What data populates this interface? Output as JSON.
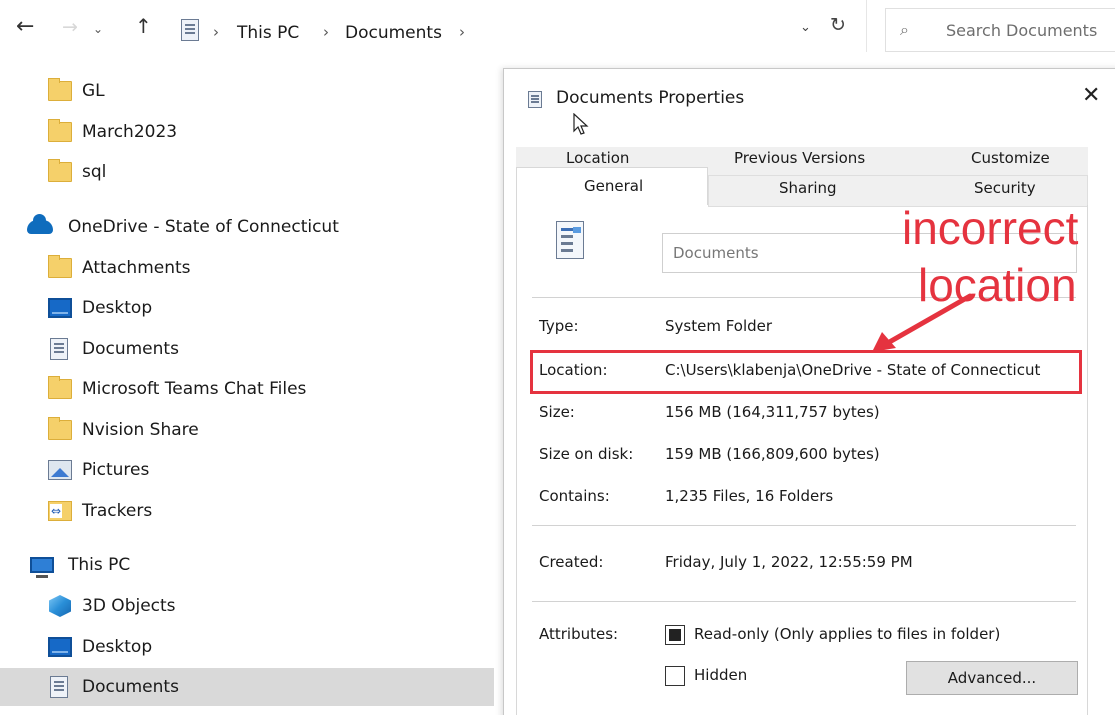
{
  "toolbar": {
    "back_glyph": "←",
    "forward_glyph": "→",
    "recent_glyph": "⌄",
    "up_glyph": "↑",
    "dropdown_glyph": "⌄",
    "refresh_glyph": "↻",
    "breadcrumb_sep": "›",
    "breadcrumb": [
      "This PC",
      "Documents"
    ],
    "search_placeholder": "Search Documents",
    "search_glyph": "⌕"
  },
  "nav_pane": {
    "items": [
      {
        "label": "GL",
        "icon": "folder-icon"
      },
      {
        "label": "March2023",
        "icon": "folder-icon"
      },
      {
        "label": "sql",
        "icon": "folder-icon"
      },
      {
        "label": "OneDrive - State of Connecticut",
        "icon": "onedrive-cloud-icon"
      },
      {
        "label": "Attachments",
        "icon": "folder-icon"
      },
      {
        "label": "Desktop",
        "icon": "desktop-icon"
      },
      {
        "label": "Documents",
        "icon": "documents-icon"
      },
      {
        "label": "Microsoft Teams Chat Files",
        "icon": "folder-icon"
      },
      {
        "label": "Nvision Share",
        "icon": "folder-icon"
      },
      {
        "label": "Pictures",
        "icon": "pictures-icon"
      },
      {
        "label": "Trackers",
        "icon": "shared-folder-icon"
      },
      {
        "label": "This PC",
        "icon": "this-pc-icon"
      },
      {
        "label": "3D Objects",
        "icon": "3d-objects-icon"
      },
      {
        "label": "Desktop",
        "icon": "desktop-icon"
      },
      {
        "label": "Documents",
        "icon": "documents-icon",
        "selected": true
      }
    ]
  },
  "dialog": {
    "title": "Documents Properties",
    "close_glyph": "✕",
    "tabs_row1": [
      "Location",
      "Previous Versions",
      "Customize"
    ],
    "tabs_row2": [
      "General",
      "Sharing",
      "Security"
    ],
    "active_tab": "General",
    "name_value": "Documents",
    "props": {
      "type_label": "Type:",
      "type_value": "System Folder",
      "location_label": "Location:",
      "location_value": "C:\\Users\\klabenja\\OneDrive - State of Connecticut",
      "size_label": "Size:",
      "size_value": "156 MB (164,311,757 bytes)",
      "size_on_disk_label": "Size on disk:",
      "size_on_disk_value": "159 MB (166,809,600 bytes)",
      "contains_label": "Contains:",
      "contains_value": "1,235 Files, 16 Folders",
      "created_label": "Created:",
      "created_value": "Friday, July 1, 2022, 12:55:59 PM",
      "attributes_label": "Attributes:"
    },
    "attributes": {
      "readonly_label": "Read-only (Only applies to files in folder)",
      "readonly_state": "mixed",
      "hidden_label": "Hidden",
      "hidden_state": "unchecked",
      "advanced_button": "Advanced..."
    }
  },
  "annotation": {
    "line1": "incorrect",
    "line2": "location",
    "color": "#e5333f"
  }
}
